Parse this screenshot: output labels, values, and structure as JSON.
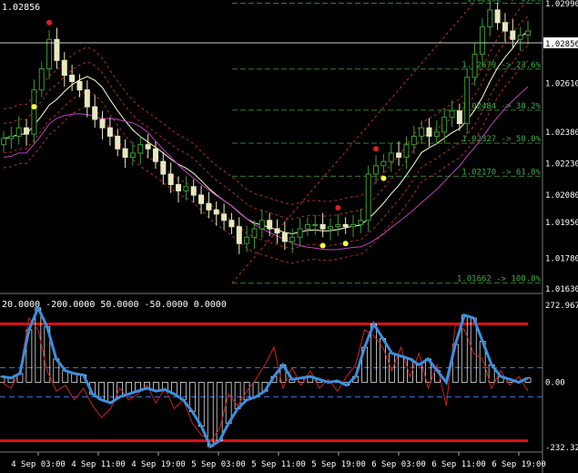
{
  "symbol_price": "1.02856",
  "current_price_tag": "1.02856",
  "price_axis_labels": [
    "1.02990",
    "1.02856",
    "1.02610",
    "1.02380",
    "1.02230",
    "1.02080",
    "1.01950",
    "1.01780",
    "1.01630"
  ],
  "fib_levels": [
    {
      "label": "1.02992 -> 0.0%"
    },
    {
      "label": "1.02679 -> 23.6%"
    },
    {
      "label": "1.02484 -> 38.2%"
    },
    {
      "label": "1.02327 -> 50.0%"
    },
    {
      "label": "1.02170 -> 61.8%"
    },
    {
      "label": "1.01662 -> 100.0%"
    }
  ],
  "indicator_header": "20.0000 -200.0000 50.0000 -50.0000 0.0000",
  "indicator_axis_labels": [
    "272.967",
    "0.00",
    "-232.322"
  ],
  "time_labels": [
    "4 Sep 03:00",
    "4 Sep 11:00",
    "4 Sep 19:00",
    "5 Sep 03:00",
    "5 Sep 11:00",
    "5 Sep 19:00",
    "6 Sep 03:00",
    "6 Sep 11:00",
    "6 Sep 19:00"
  ],
  "colors": {
    "background": "#000000",
    "bull_candle": "#3a9d2e",
    "bear_candle": "#e8e8c0",
    "bollinger": "#b03020",
    "moving_average": "#ffffcc",
    "lower_band": "#c040c0",
    "fib": "#2e7d2e",
    "fib_text": "#3cb043",
    "cci_main": "#3a8fe0",
    "cci_fast": "#cc2222",
    "level_line": "#dd1111",
    "hist": "#ffffff"
  },
  "chart_data": {
    "type": "line",
    "instrument_price_range": [
      1.0163,
      1.0299
    ],
    "indicator_range": [
      -232.322,
      272.967
    ],
    "indicator_levels": [
      200,
      50,
      0,
      -50,
      -200
    ],
    "candle_closes": [
      1.0235,
      1.0236,
      1.024,
      1.0237,
      1.0258,
      1.0268,
      1.0282,
      1.0272,
      1.0265,
      1.0262,
      1.0258,
      1.025,
      1.0244,
      1.024,
      1.0236,
      1.023,
      1.0226,
      1.0228,
      1.0232,
      1.023,
      1.0224,
      1.0218,
      1.0213,
      1.021,
      1.0212,
      1.0208,
      1.0204,
      1.0201,
      1.0199,
      1.0196,
      1.0193,
      1.0185,
      1.0188,
      1.0192,
      1.0196,
      1.0192,
      1.019,
      1.0186,
      1.0188,
      1.0192,
      1.0194,
      1.0194,
      1.0192,
      1.0193,
      1.0194,
      1.0193,
      1.0194,
      1.0196,
      1.0218,
      1.0222,
      1.0224,
      1.0228,
      1.0226,
      1.0232,
      1.0236,
      1.024,
      1.0236,
      1.0238,
      1.0245,
      1.0248,
      1.0242,
      1.0264,
      1.0275,
      1.0288,
      1.0296,
      1.029,
      1.0286,
      1.0282,
      1.0284,
      1.0286
    ],
    "cci_main": [
      20,
      15,
      30,
      180,
      255,
      190,
      80,
      40,
      30,
      25,
      -40,
      -60,
      -70,
      -50,
      -40,
      -30,
      -20,
      -30,
      -25,
      -40,
      -60,
      -100,
      -150,
      -220,
      -200,
      -140,
      -90,
      -60,
      -50,
      -30,
      20,
      60,
      10,
      15,
      20,
      10,
      0,
      5,
      -10,
      20,
      120,
      200,
      150,
      100,
      90,
      80,
      60,
      80,
      40,
      0,
      130,
      230,
      220,
      140,
      60,
      20,
      10,
      0,
      15
    ],
    "cci_fast": [
      0,
      -20,
      40,
      220,
      180,
      40,
      -30,
      -10,
      -60,
      -20,
      -80,
      -120,
      -90,
      -20,
      -60,
      -40,
      -10,
      -70,
      -20,
      -90,
      -60,
      -140,
      -180,
      -200,
      -160,
      -40,
      -80,
      -30,
      10,
      60,
      120,
      -20,
      50,
      -10,
      40,
      -20,
      10,
      -30,
      20,
      60,
      180,
      160,
      120,
      40,
      120,
      20,
      100,
      -20,
      60,
      -80,
      200,
      180,
      100,
      80,
      -20,
      40,
      -10,
      20,
      -30
    ]
  }
}
